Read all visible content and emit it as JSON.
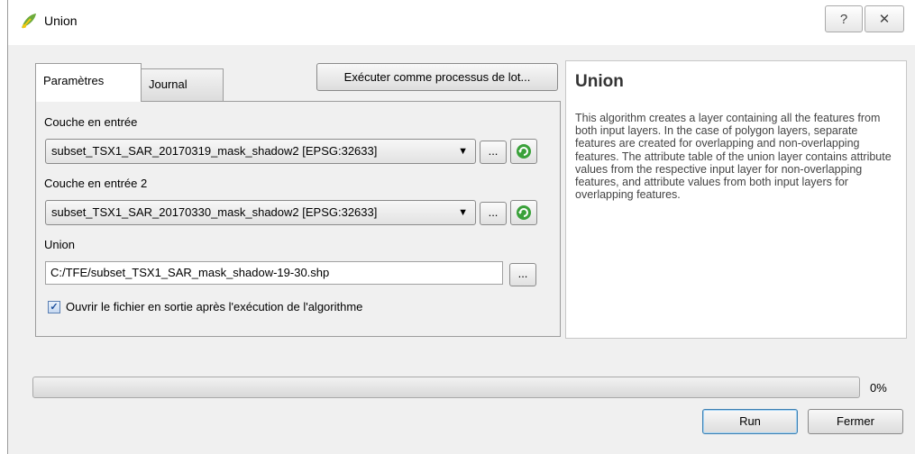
{
  "window": {
    "title": "Union",
    "help_glyph": "?",
    "close_glyph": "✕"
  },
  "tabs": {
    "params_label": "Paramètres",
    "journal_label": "Journal"
  },
  "batch_button_label": "Exécuter comme processus de lot...",
  "form": {
    "input1_label": "Couche en entrée",
    "input1_value": "subset_TSX1_SAR_20170319_mask_shadow2 [EPSG:32633]",
    "input2_label": "Couche en entrée 2",
    "input2_value": "subset_TSX1_SAR_20170330_mask_shadow2 [EPSG:32633]",
    "output_label": "Union",
    "output_value": "C:/TFE/subset_TSX1_SAR_mask_shadow-19-30.shp",
    "browse_label": "...",
    "open_output_label": "Ouvrir le fichier en sortie après l'exécution de l'algorithme",
    "open_output_checked": true
  },
  "help": {
    "title": "Union",
    "body": "This algorithm creates a layer containing all the features from both input layers. In the case of polygon layers, separate features are created for overlapping and non-overlapping features. The attribute table of the union layer contains attribute values from the respective input layer for non-overlapping features, and attribute values from both input layers for overlapping features."
  },
  "progress": {
    "value": 0,
    "label": "0%"
  },
  "buttons": {
    "run": "Run",
    "close": "Fermer"
  },
  "icons": {
    "app": "qgis-icon",
    "refresh": "refresh-icon",
    "dropdown": "chevron-down-icon"
  },
  "colors": {
    "accent": "#3c7fb1",
    "refresh_green": "#3aa13a"
  }
}
